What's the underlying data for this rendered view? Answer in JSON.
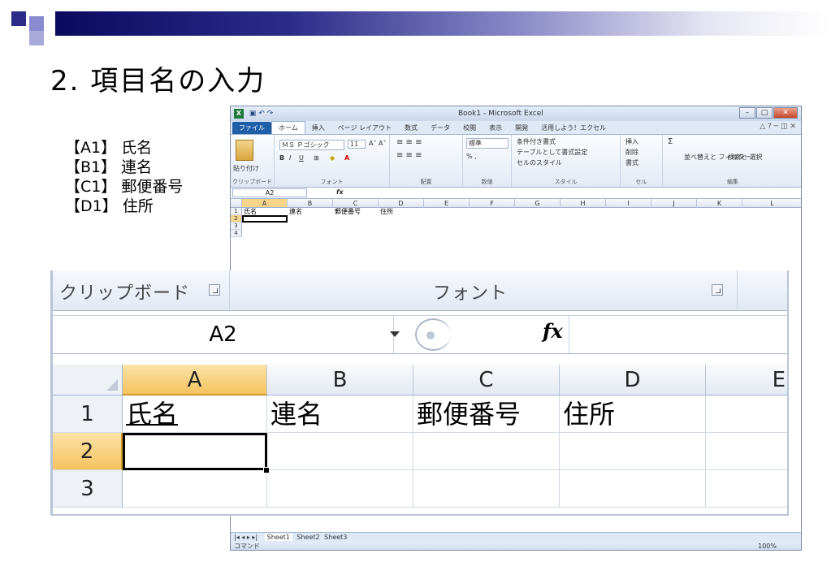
{
  "slide": {
    "title": "2. 項目名の入力",
    "assignments": [
      {
        "cell": "【A1】",
        "value": "氏名"
      },
      {
        "cell": "【B1】",
        "value": "連名"
      },
      {
        "cell": "【C1】",
        "value": "郵便番号"
      },
      {
        "cell": "【D1】",
        "value": "住所"
      }
    ]
  },
  "excel": {
    "window_title": "Book1 - Microsoft Excel",
    "tabs": [
      "ファイル",
      "ホーム",
      "挿入",
      "ページ レイアウト",
      "数式",
      "データ",
      "校閲",
      "表示",
      "開発",
      "活用しよう！エクセル"
    ],
    "active_tab": "ホーム",
    "ribbon": {
      "paste_label": "貼り付け",
      "font_name": "ＭＳ Ｐゴシック",
      "font_size": "11",
      "number_format": "標準",
      "cond_format": "条件付き書式",
      "table_format": "テーブルとして書式設定",
      "cell_styles": "セルのスタイル",
      "insert": "挿入",
      "delete": "削除",
      "format": "書式",
      "sort_filter": "並べ替えと フィルター",
      "find_select": "検索と 選択",
      "groups": {
        "clipboard": "クリップボード",
        "font": "フォント",
        "alignment": "配置",
        "number": "数値",
        "styles": "スタイル",
        "cells": "セル",
        "editing": "編集"
      }
    },
    "name_box": "A2",
    "columns": [
      "A",
      "B",
      "C",
      "D",
      "E",
      "F",
      "G",
      "H",
      "I",
      "J",
      "K",
      "L"
    ],
    "rows": [
      "1",
      "2",
      "3",
      "4"
    ],
    "row1": [
      "氏名",
      "連名",
      "郵便番号",
      "住所"
    ],
    "sheet_tabs": [
      "Sheet1",
      "Sheet2",
      "Sheet3"
    ],
    "status_mode": "コマンド",
    "zoom": "100%"
  },
  "zoom_view": {
    "clipboard_label": "クリップボード",
    "font_label": "フォント",
    "name_box": "A2",
    "fx": "fx",
    "columns": [
      "A",
      "B",
      "C",
      "D",
      "E"
    ],
    "rows": [
      "1",
      "2",
      "3"
    ],
    "row1": [
      "氏名",
      "連名",
      "郵便番号",
      "住所"
    ]
  },
  "colors": {
    "title_bar_dark": "#0a0a60",
    "selected_header": "#f6c35f",
    "file_tab": "#1f5fa8"
  }
}
